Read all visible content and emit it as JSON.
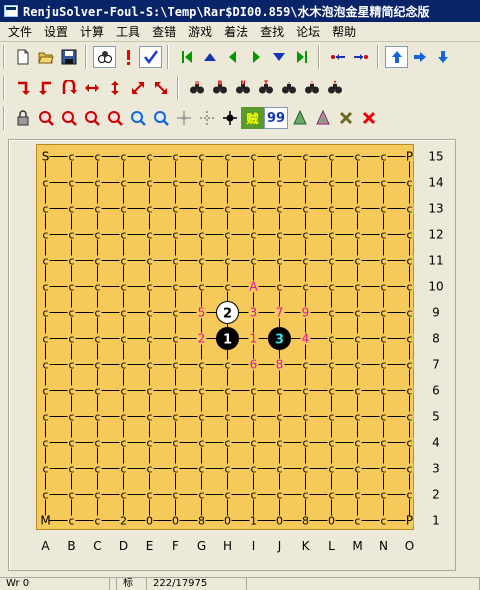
{
  "window": {
    "title": "RenjuSolver-Foul-S:\\Temp\\Rar$DI00.859\\水木泡泡金星精简纪念版"
  },
  "menu": [
    "文件",
    "设置",
    "计算",
    "工具",
    "查错",
    "游戏",
    "着法",
    "查找",
    "论坛",
    "帮助"
  ],
  "toolbar1": [
    [
      "new-file-icon",
      "open-folder-icon",
      "save-disk-icon"
    ],
    [
      "stones-icon",
      "exclamation-icon",
      "checkmark-icon"
    ],
    [
      "first-move-icon",
      "step-up-icon",
      "previous-move-icon",
      "next-move-icon",
      "step-down-icon",
      "last-move-icon"
    ],
    [
      "link-left-icon",
      "link-right-icon"
    ],
    [
      "arrow-up-icon",
      "arrow-right-icon",
      "arrow-down-icon"
    ]
  ],
  "toolbar2": [
    [
      "turn-right-icon",
      "turn-left-down-icon",
      "u-turn-icon",
      "horizontal-arrow-icon",
      "vertical-arrow-icon",
      "diagonal-up-icon",
      "diagonal-down-icon"
    ],
    [
      "find-list-icon",
      "find-b-icon",
      "find-n-icon",
      "find-text-icon",
      "find-pattern-icon",
      "find-pattern-2-icon",
      "find-up-icon"
    ]
  ],
  "toolbar3": [
    [
      "lock-icon",
      "zoom-red-1-icon",
      "zoom-red-2-icon",
      "zoom-red-3-icon",
      "zoom-red-4-icon",
      "zoom-in-icon",
      "zoom-out-icon",
      "crosshair-grey-icon",
      "dotted-cross-icon",
      "black-cross-icon",
      "thief-icon",
      "99-icon",
      "tree-icon",
      "tree-2-icon",
      "cancel-x-icon",
      "delete-x-icon"
    ]
  ],
  "toolbar3_text": {
    "num_label": "99",
    "thief_label": "贼"
  },
  "board": {
    "size": 15,
    "columns": [
      "A",
      "B",
      "C",
      "D",
      "E",
      "F",
      "G",
      "H",
      "I",
      "J",
      "K",
      "L",
      "M",
      "N",
      "O"
    ],
    "rows": [
      "15",
      "14",
      "13",
      "12",
      "11",
      "10",
      "9",
      "8",
      "7",
      "6",
      "5",
      "4",
      "3",
      "2",
      "1"
    ],
    "default_mark": "c",
    "corner_marks": {
      "A15": "S",
      "O15": "P",
      "O1": "P",
      "A1": "M"
    },
    "edge_marks": {
      "D1": "2",
      "E1": "0",
      "F1": "0",
      "G1": "8",
      "H1": "0",
      "I1": "1",
      "J1": "0",
      "K1": "8",
      "L1": "0",
      "M1": "c"
    },
    "stones": [
      {
        "move": "1",
        "color": "black",
        "pos": "H8"
      },
      {
        "move": "2",
        "color": "white",
        "pos": "H9"
      },
      {
        "move": "3",
        "color": "black",
        "pos": "J8",
        "last": true
      }
    ],
    "marks": [
      {
        "label": "A",
        "pos": "I10"
      },
      {
        "label": "5",
        "pos": "G9"
      },
      {
        "label": "3",
        "pos": "I9"
      },
      {
        "label": "7",
        "pos": "J9"
      },
      {
        "label": "9",
        "pos": "K9"
      },
      {
        "label": "2",
        "pos": "G8"
      },
      {
        "label": "1",
        "pos": "I8"
      },
      {
        "label": "4",
        "pos": "K8"
      },
      {
        "label": "6",
        "pos": "I7"
      },
      {
        "label": "8",
        "pos": "J7"
      }
    ],
    "colors": {
      "board": "#f5c95a",
      "line": "#000000",
      "mark": "#e010a0",
      "last_move_text": "#40e0e0"
    }
  },
  "status": {
    "cell1": "Wr 0",
    "cell2": "",
    "cell3": "标",
    "cell4": "222/17975",
    "cell5": ""
  }
}
